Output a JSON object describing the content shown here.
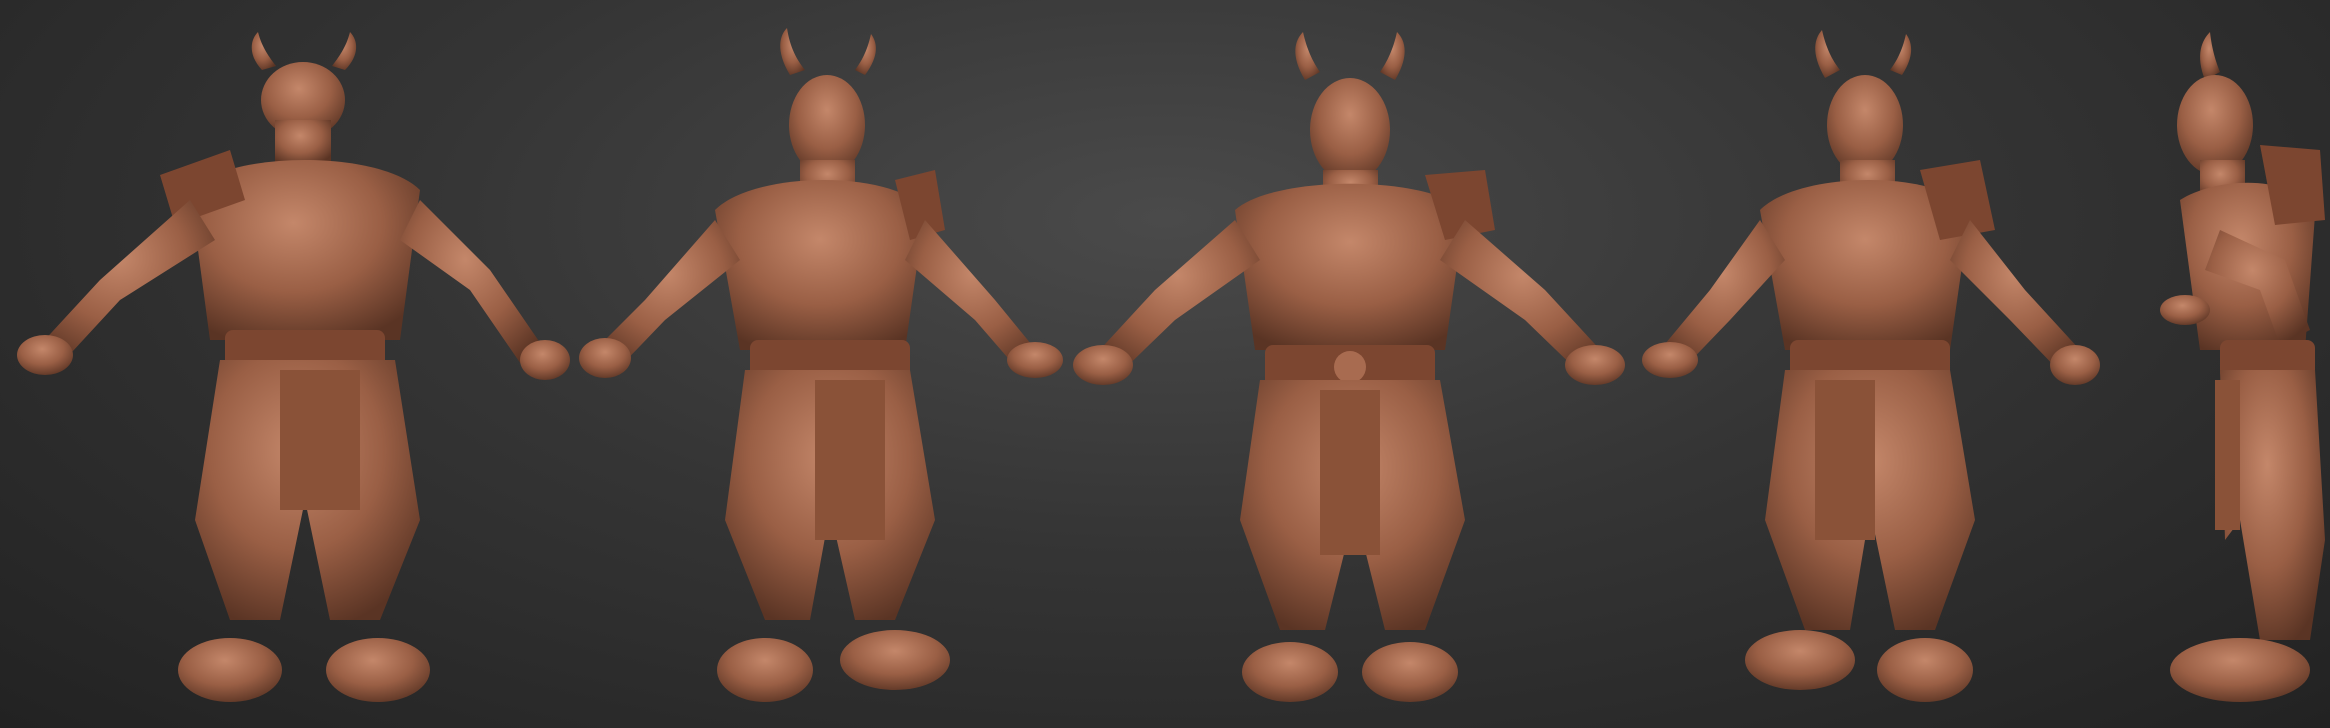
{
  "scene": {
    "subject": "horned-helmet-barbarian-sculpt",
    "material_color": "#9a5f45",
    "shadow_color": "#5a3424",
    "highlight_color": "#c4876a",
    "background": "#2e2e2e"
  },
  "views": [
    {
      "id": "back",
      "icon": "figure-back"
    },
    {
      "id": "front-three-quarter-left",
      "icon": "figure-3q-left"
    },
    {
      "id": "front",
      "icon": "figure-front"
    },
    {
      "id": "front-three-quarter-right",
      "icon": "figure-3q-right"
    },
    {
      "id": "side",
      "icon": "figure-side"
    }
  ]
}
